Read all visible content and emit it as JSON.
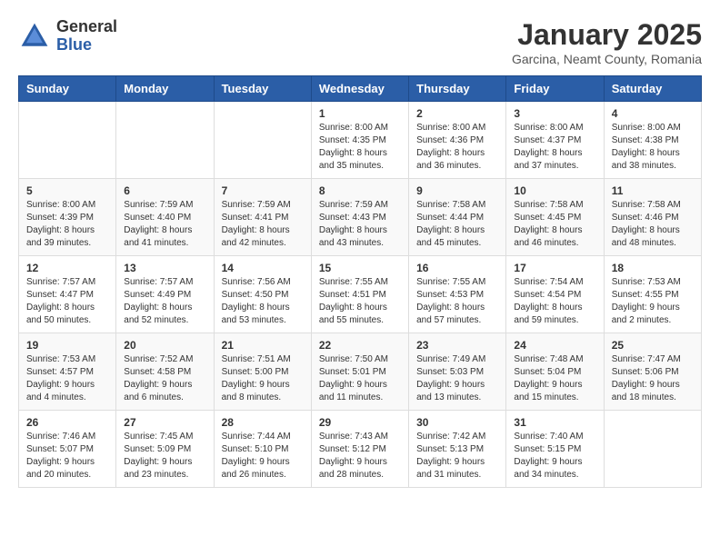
{
  "logo": {
    "general": "General",
    "blue": "Blue"
  },
  "title": "January 2025",
  "subtitle": "Garcina, Neamt County, Romania",
  "days_of_week": [
    "Sunday",
    "Monday",
    "Tuesday",
    "Wednesday",
    "Thursday",
    "Friday",
    "Saturday"
  ],
  "weeks": [
    [
      {
        "day": "",
        "info": ""
      },
      {
        "day": "",
        "info": ""
      },
      {
        "day": "",
        "info": ""
      },
      {
        "day": "1",
        "info": "Sunrise: 8:00 AM\nSunset: 4:35 PM\nDaylight: 8 hours and 35 minutes."
      },
      {
        "day": "2",
        "info": "Sunrise: 8:00 AM\nSunset: 4:36 PM\nDaylight: 8 hours and 36 minutes."
      },
      {
        "day": "3",
        "info": "Sunrise: 8:00 AM\nSunset: 4:37 PM\nDaylight: 8 hours and 37 minutes."
      },
      {
        "day": "4",
        "info": "Sunrise: 8:00 AM\nSunset: 4:38 PM\nDaylight: 8 hours and 38 minutes."
      }
    ],
    [
      {
        "day": "5",
        "info": "Sunrise: 8:00 AM\nSunset: 4:39 PM\nDaylight: 8 hours and 39 minutes."
      },
      {
        "day": "6",
        "info": "Sunrise: 7:59 AM\nSunset: 4:40 PM\nDaylight: 8 hours and 41 minutes."
      },
      {
        "day": "7",
        "info": "Sunrise: 7:59 AM\nSunset: 4:41 PM\nDaylight: 8 hours and 42 minutes."
      },
      {
        "day": "8",
        "info": "Sunrise: 7:59 AM\nSunset: 4:43 PM\nDaylight: 8 hours and 43 minutes."
      },
      {
        "day": "9",
        "info": "Sunrise: 7:58 AM\nSunset: 4:44 PM\nDaylight: 8 hours and 45 minutes."
      },
      {
        "day": "10",
        "info": "Sunrise: 7:58 AM\nSunset: 4:45 PM\nDaylight: 8 hours and 46 minutes."
      },
      {
        "day": "11",
        "info": "Sunrise: 7:58 AM\nSunset: 4:46 PM\nDaylight: 8 hours and 48 minutes."
      }
    ],
    [
      {
        "day": "12",
        "info": "Sunrise: 7:57 AM\nSunset: 4:47 PM\nDaylight: 8 hours and 50 minutes."
      },
      {
        "day": "13",
        "info": "Sunrise: 7:57 AM\nSunset: 4:49 PM\nDaylight: 8 hours and 52 minutes."
      },
      {
        "day": "14",
        "info": "Sunrise: 7:56 AM\nSunset: 4:50 PM\nDaylight: 8 hours and 53 minutes."
      },
      {
        "day": "15",
        "info": "Sunrise: 7:55 AM\nSunset: 4:51 PM\nDaylight: 8 hours and 55 minutes."
      },
      {
        "day": "16",
        "info": "Sunrise: 7:55 AM\nSunset: 4:53 PM\nDaylight: 8 hours and 57 minutes."
      },
      {
        "day": "17",
        "info": "Sunrise: 7:54 AM\nSunset: 4:54 PM\nDaylight: 8 hours and 59 minutes."
      },
      {
        "day": "18",
        "info": "Sunrise: 7:53 AM\nSunset: 4:55 PM\nDaylight: 9 hours and 2 minutes."
      }
    ],
    [
      {
        "day": "19",
        "info": "Sunrise: 7:53 AM\nSunset: 4:57 PM\nDaylight: 9 hours and 4 minutes."
      },
      {
        "day": "20",
        "info": "Sunrise: 7:52 AM\nSunset: 4:58 PM\nDaylight: 9 hours and 6 minutes."
      },
      {
        "day": "21",
        "info": "Sunrise: 7:51 AM\nSunset: 5:00 PM\nDaylight: 9 hours and 8 minutes."
      },
      {
        "day": "22",
        "info": "Sunrise: 7:50 AM\nSunset: 5:01 PM\nDaylight: 9 hours and 11 minutes."
      },
      {
        "day": "23",
        "info": "Sunrise: 7:49 AM\nSunset: 5:03 PM\nDaylight: 9 hours and 13 minutes."
      },
      {
        "day": "24",
        "info": "Sunrise: 7:48 AM\nSunset: 5:04 PM\nDaylight: 9 hours and 15 minutes."
      },
      {
        "day": "25",
        "info": "Sunrise: 7:47 AM\nSunset: 5:06 PM\nDaylight: 9 hours and 18 minutes."
      }
    ],
    [
      {
        "day": "26",
        "info": "Sunrise: 7:46 AM\nSunset: 5:07 PM\nDaylight: 9 hours and 20 minutes."
      },
      {
        "day": "27",
        "info": "Sunrise: 7:45 AM\nSunset: 5:09 PM\nDaylight: 9 hours and 23 minutes."
      },
      {
        "day": "28",
        "info": "Sunrise: 7:44 AM\nSunset: 5:10 PM\nDaylight: 9 hours and 26 minutes."
      },
      {
        "day": "29",
        "info": "Sunrise: 7:43 AM\nSunset: 5:12 PM\nDaylight: 9 hours and 28 minutes."
      },
      {
        "day": "30",
        "info": "Sunrise: 7:42 AM\nSunset: 5:13 PM\nDaylight: 9 hours and 31 minutes."
      },
      {
        "day": "31",
        "info": "Sunrise: 7:40 AM\nSunset: 5:15 PM\nDaylight: 9 hours and 34 minutes."
      },
      {
        "day": "",
        "info": ""
      }
    ]
  ]
}
